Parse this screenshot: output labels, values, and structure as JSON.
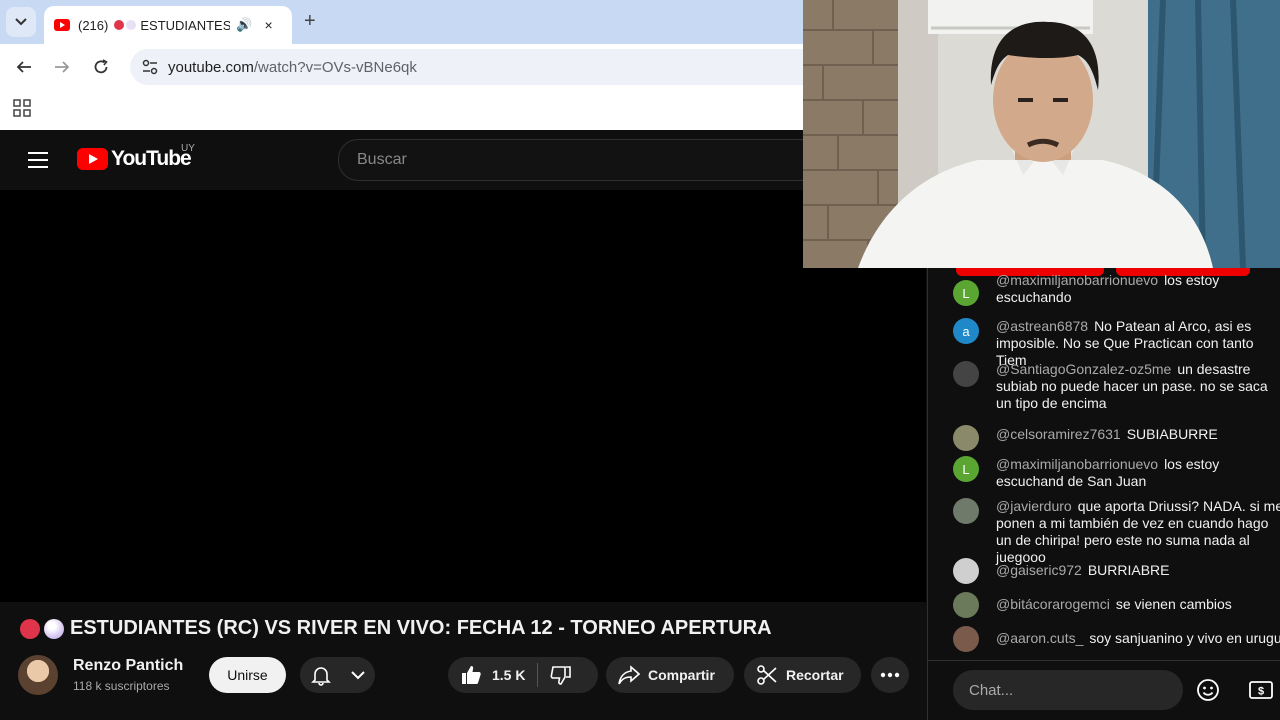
{
  "browser": {
    "tab": {
      "count_prefix": "(216)",
      "title": "ESTUDIANTES (",
      "close": "×"
    },
    "newtab": "+",
    "url_host": "youtube.com",
    "url_path": "/watch?v=OVs-vBNe6qk"
  },
  "youtube": {
    "logo_text": "YouTube",
    "country": "UY",
    "search_placeholder": "Buscar",
    "video_title": "ESTUDIANTES (RC) VS RIVER EN VIVO: FECHA 12 - TORNEO APERTURA",
    "channel_name": "Renzo Pantich",
    "subscribers": "118 k suscriptores",
    "join_label": "Unirse",
    "likes": "1.5 K",
    "share_label": "Compartir",
    "clip_label": "Recortar"
  },
  "chat": {
    "placeholder": "Chat...",
    "messages": [
      {
        "author": "@maximiljanobarrionuevo",
        "text": "los estoy escuchando",
        "avatar": "L",
        "avatar_color": "#5ba633"
      },
      {
        "author": "@astrean6878",
        "text": "No Patean al Arco, asi es imposible. No se Que Practican con tanto Tiem",
        "avatar": "a",
        "avatar_color": "#1e88c9"
      },
      {
        "author": "@SantiagoGonzalez-oz5me",
        "text": "un desastre subiab no puede hacer un pase. no se saca un tipo de encima",
        "avatar": "",
        "avatar_color": "#444444"
      },
      {
        "author": "@celsoramirez7631",
        "text": "SUBIABURRE",
        "avatar": "",
        "avatar_color": "#8a8a6a"
      },
      {
        "author": "@maximiljanobarrionuevo",
        "text": "los estoy escuchand de San Juan",
        "avatar": "L",
        "avatar_color": "#5ba633"
      },
      {
        "author": "@javierduro",
        "text": "que aporta Driussi? NADA. si me ponen a mi también de vez en cuando hago un de chiripa! pero este no suma nada al juegooo",
        "avatar": "",
        "avatar_color": "#6f7a6a"
      },
      {
        "author": "@gaiseric972",
        "text": "BURRIABRE",
        "avatar": "",
        "avatar_color": "#cfcfcf"
      },
      {
        "author": "@bitácorarogemci",
        "text": "se vienen cambios",
        "avatar": "",
        "avatar_color": "#6a7a5a"
      },
      {
        "author": "@aaron.cuts_",
        "text": "soy sanjuanino y vivo en urugua",
        "avatar": "",
        "avatar_color": "#7a5a4a"
      }
    ]
  },
  "colors": {
    "youtube_red": "#ff0000",
    "dot_red": "#e0344a",
    "dot_lilac": "#d8c8f0"
  }
}
